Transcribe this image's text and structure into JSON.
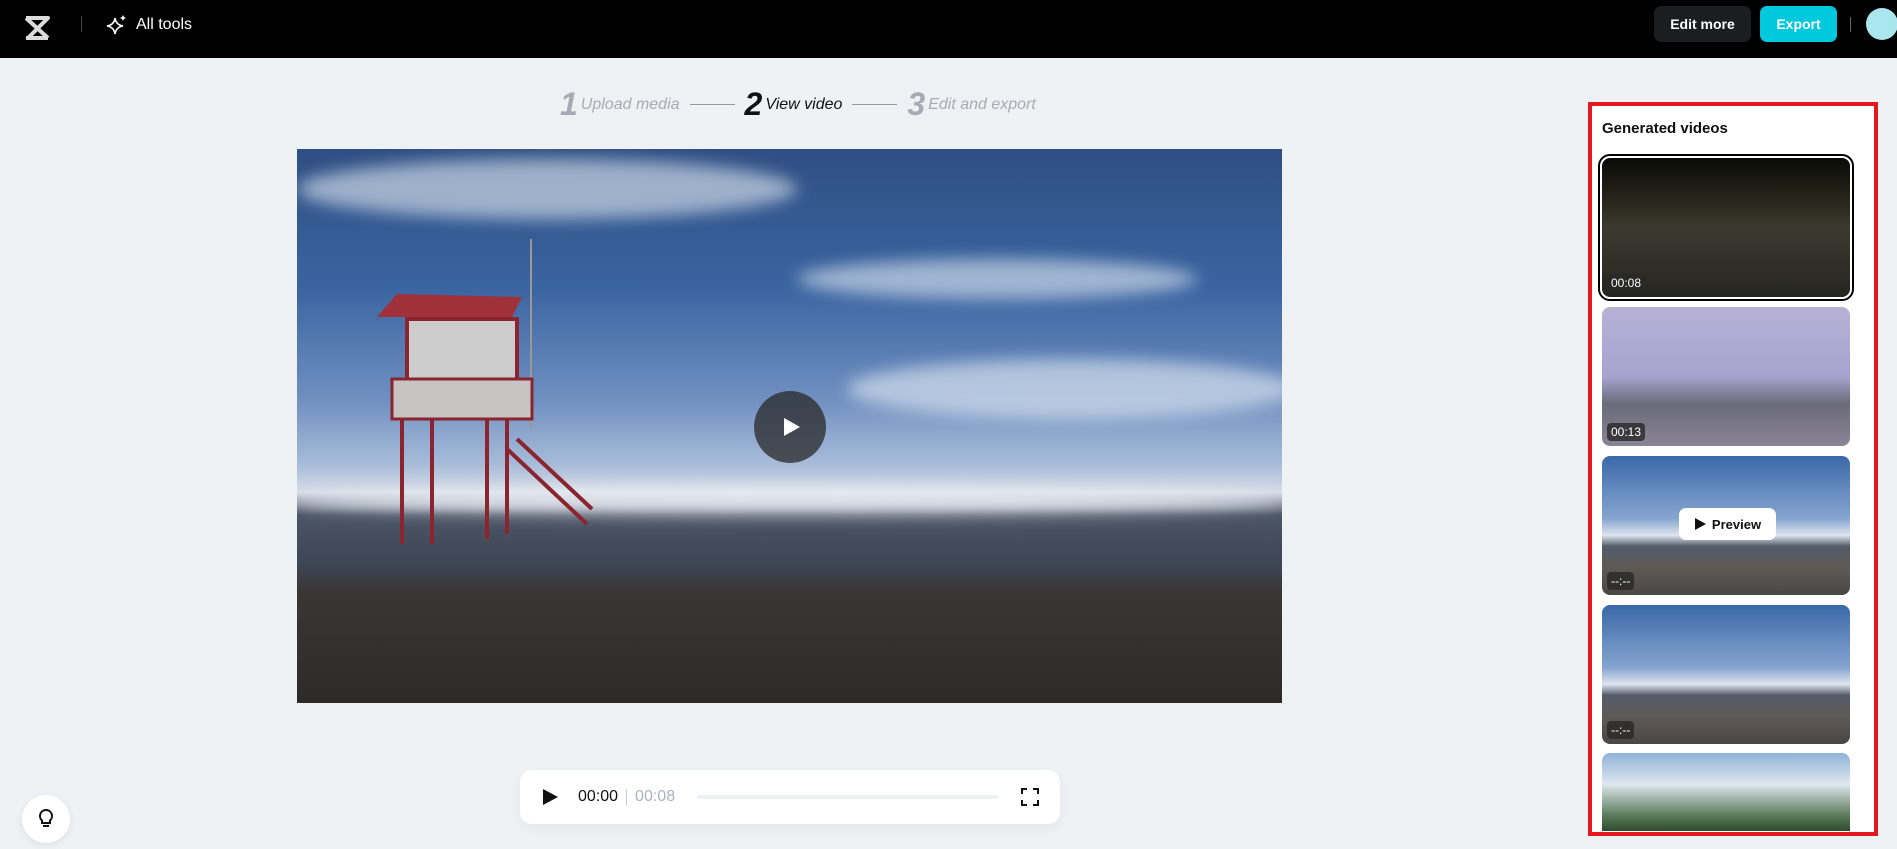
{
  "header": {
    "all_tools": "All tools",
    "edit_more": "Edit more",
    "export": "Export"
  },
  "steps": [
    {
      "num": "1",
      "label": "Upload media"
    },
    {
      "num": "2",
      "label": "View video"
    },
    {
      "num": "3",
      "label": "Edit and export"
    }
  ],
  "player": {
    "current": "00:00",
    "duration": "00:08",
    "progress": 0
  },
  "panel": {
    "title": "Generated videos",
    "preview_label": "Preview",
    "videos": [
      {
        "duration": "00:08"
      },
      {
        "duration": "00:13"
      },
      {
        "duration": "--:--"
      },
      {
        "duration": "--:--"
      },
      {
        "duration": ""
      }
    ]
  },
  "colors": {
    "export": "#00c8dd",
    "highlight": "#e3191e"
  }
}
